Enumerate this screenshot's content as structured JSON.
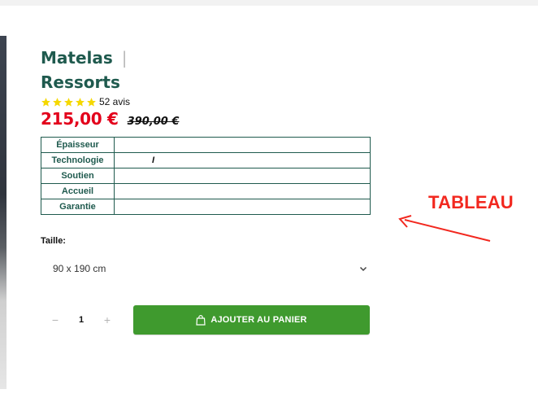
{
  "product": {
    "title_line1": "Matelas",
    "title_separator": "|",
    "title_line2": "Ressorts",
    "rating": {
      "stars": 5,
      "reviews_label": "52 avis",
      "star_color": "#f5d800"
    },
    "price": {
      "current": "215,00 €",
      "old": "390,00 €",
      "current_color": "#e3001b"
    }
  },
  "specs": {
    "rows": [
      {
        "label": "Épaisseur",
        "value": ""
      },
      {
        "label": "Technologie",
        "value": "I"
      },
      {
        "label": "Soutien",
        "value": ""
      },
      {
        "label": "Accueil",
        "value": ""
      },
      {
        "label": "Garantie",
        "value": ""
      }
    ],
    "border_color": "#1f5a4e"
  },
  "annotation": {
    "text": "TABLEAU",
    "color": "#f2281f"
  },
  "size": {
    "label": "Taille:",
    "selected": "90 x 190 cm"
  },
  "quantity": {
    "value": "1",
    "minus": "−",
    "plus": "+"
  },
  "cart": {
    "button_label": "AJOUTER AU PANIER",
    "button_color": "#3f9a2e"
  },
  "icons": {
    "rating": "star-icon",
    "select": "chevron-down-icon",
    "cart": "shopping-bag-icon",
    "annotation": "arrow-icon"
  }
}
